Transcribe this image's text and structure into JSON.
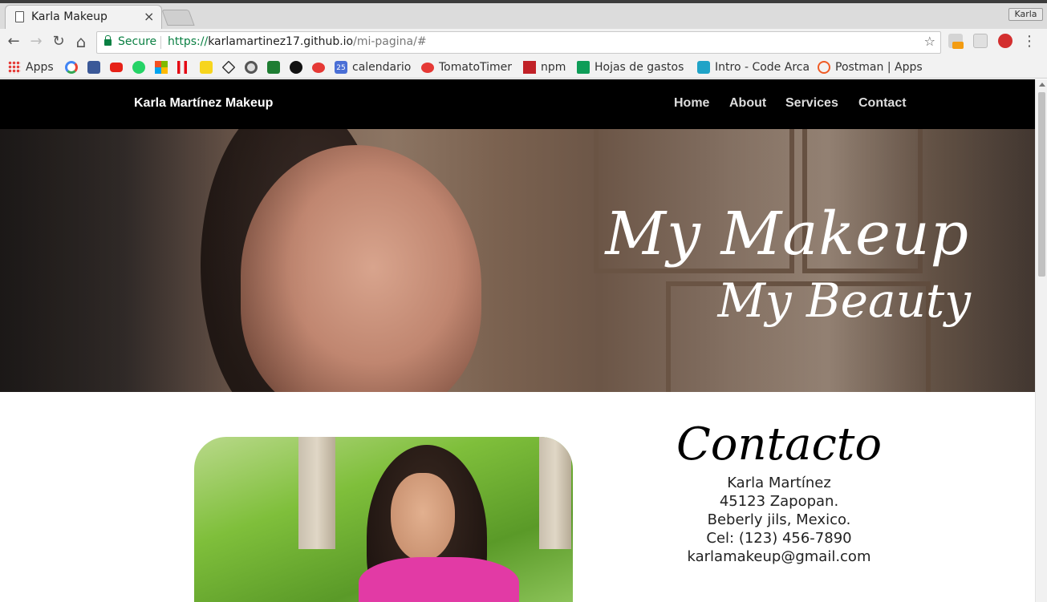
{
  "browser": {
    "tab_title": "Karla Makeup",
    "tab_close": "×",
    "profile": "Karla",
    "secure_label": "Secure",
    "url_scheme": "https://",
    "url_host": "karlamartinez17.github.io",
    "url_path": "/mi-pagina/#",
    "back_icon": "←",
    "forward_icon": "→",
    "reload_icon": "↻",
    "home_icon": "⌂",
    "star_icon": "☆",
    "menu_icon": "⋮",
    "more_bookmarks": "»",
    "bookmarks": {
      "apps": "Apps",
      "calendario": "calendario",
      "tomatotimer": "TomatoTimer",
      "npm": "npm",
      "hojas": "Hojas de gastos",
      "intro": "Intro - Code Arca",
      "postman": "Postman | Apps",
      "calendar_day": "25"
    }
  },
  "site": {
    "brand": "Karla Martínez Makeup",
    "nav": {
      "home": "Home",
      "about": "About",
      "services": "Services",
      "contact": "Contact"
    },
    "hero": {
      "title": "My Makeup",
      "subtitle": "My Beauty"
    },
    "contact": {
      "heading": "Contacto",
      "name": "Karla Martínez",
      "address1": "45123 Zapopan.",
      "address2": "Beberly jils, Mexico.",
      "phone": "Cel: (123) 456-7890",
      "email": "karlamakeup@gmail.com"
    }
  },
  "colors": {
    "navbar_bg": "#000000",
    "secure_green": "#0b8043",
    "hero_text": "#ffffff"
  }
}
